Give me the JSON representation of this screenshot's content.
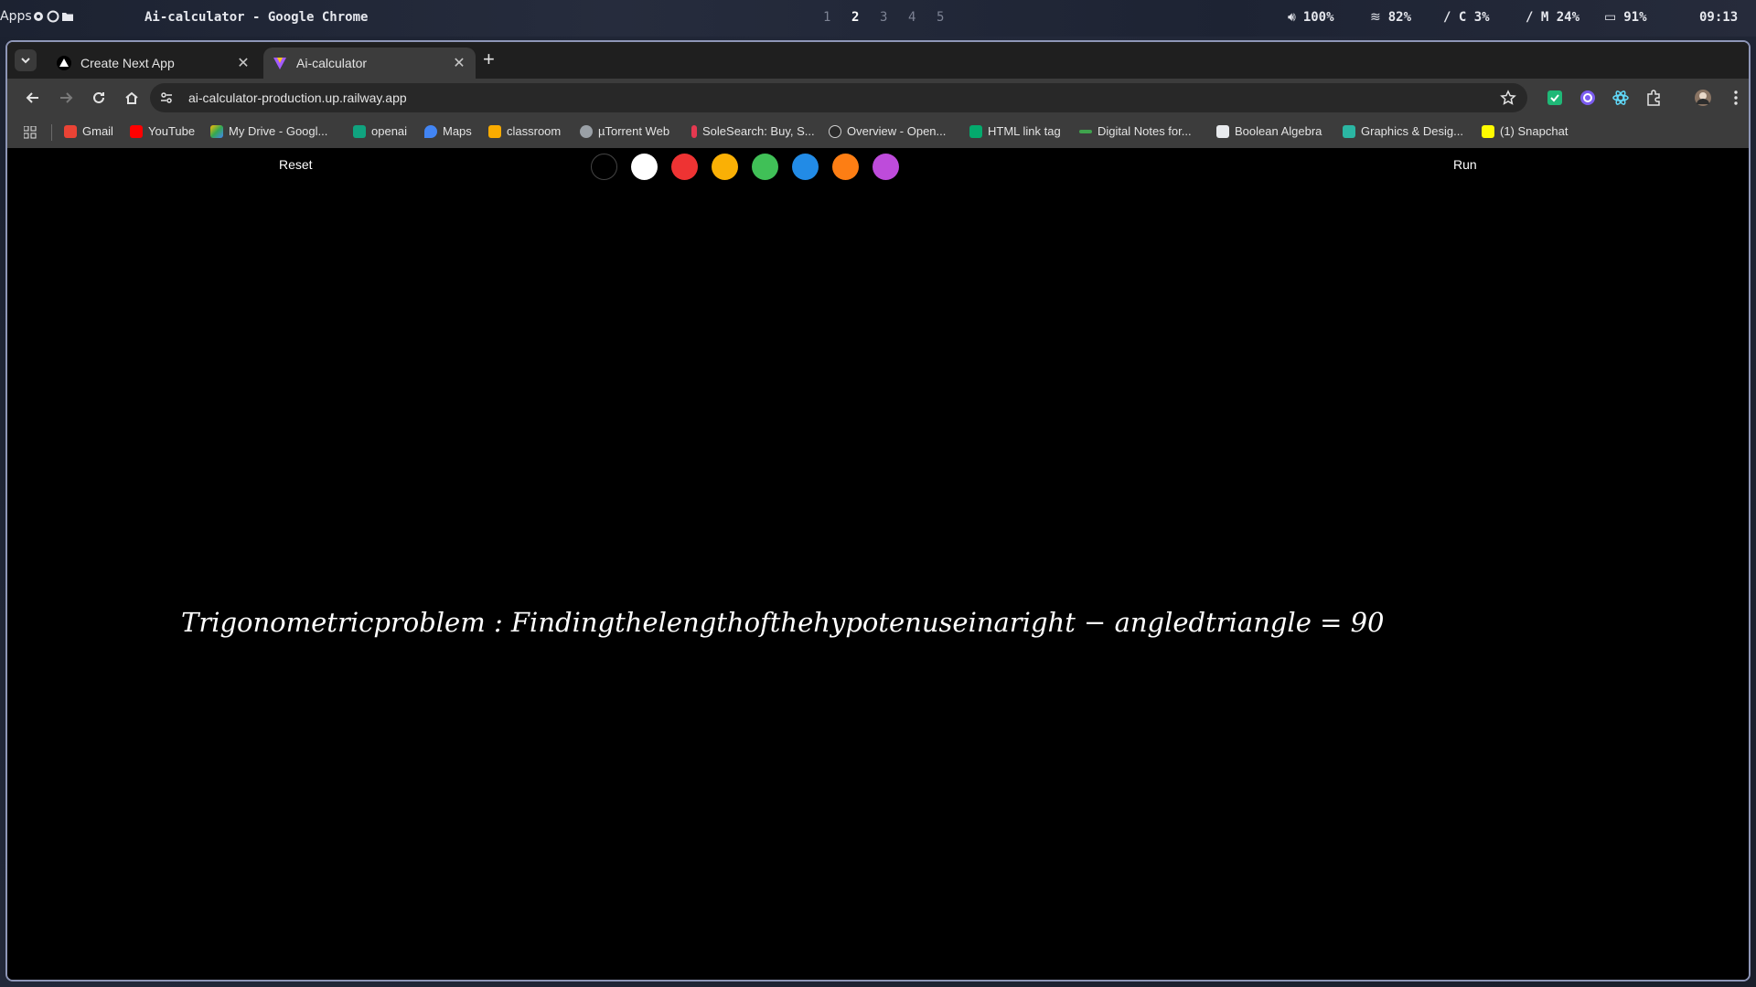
{
  "system_bar": {
    "apps_label": "Apps",
    "window_title": "Ai-calculator - Google Chrome",
    "workspaces": [
      "1",
      "2",
      "3",
      "4",
      "5"
    ],
    "active_workspace": "2",
    "volume": "100%",
    "wifi": "82%",
    "cpu": "/ C 3%",
    "memory": "/ M 24%",
    "battery": "91%",
    "clock": "09:13"
  },
  "browser": {
    "tabs": [
      {
        "title": "Create Next App",
        "active": false,
        "icon": "nextjs-triangle-icon"
      },
      {
        "title": "Ai-calculator",
        "active": true,
        "icon": "vite-logo-icon"
      }
    ],
    "url": "ai-calculator-production.up.railway.app",
    "bookmarks": [
      {
        "label": "Gmail",
        "icon": "gmail-icon",
        "color": "#ea4335"
      },
      {
        "label": "YouTube",
        "icon": "youtube-icon",
        "color": "#ff0000"
      },
      {
        "label": "My Drive - Googl...",
        "icon": "drive-icon",
        "color": "#34a853"
      },
      {
        "label": "openai",
        "icon": "openai-icon",
        "color": "#10a37f"
      },
      {
        "label": "Maps",
        "icon": "maps-icon",
        "color": "#4285f4"
      },
      {
        "label": "classroom",
        "icon": "classroom-icon",
        "color": "#f9ab00"
      },
      {
        "label": "µTorrent Web",
        "icon": "globe-icon",
        "color": "#9aa0a6"
      },
      {
        "label": "SoleSearch: Buy, S...",
        "icon": "solesearch-icon",
        "color": "#e53950"
      },
      {
        "label": "Overview - Open...",
        "icon": "openai-dark-icon",
        "color": "#d0d0d0"
      },
      {
        "label": "HTML link tag",
        "icon": "w3-icon",
        "color": "#04aa6d"
      },
      {
        "label": "Digital Notes for...",
        "icon": "notes-icon",
        "color": "#3fa34d"
      },
      {
        "label": "Boolean Algebra",
        "icon": "boolean-icon",
        "color": "#e8eaed"
      },
      {
        "label": "Graphics & Desig...",
        "icon": "graphics-icon",
        "color": "#2bb6a3"
      },
      {
        "label": "(1) Snapchat",
        "icon": "snapchat-icon",
        "color": "#fffc00"
      }
    ]
  },
  "app": {
    "reset_label": "Reset",
    "run_label": "Run",
    "swatches": [
      "#000000",
      "#ffffff",
      "#ee3333",
      "#fab005",
      "#40c057",
      "#228be6",
      "#fd7e14",
      "#be4bdb"
    ],
    "result_text": "Trigonometricproblem : Findingthelengthofthehypotenuseinaright − angledtriangle = 90"
  }
}
